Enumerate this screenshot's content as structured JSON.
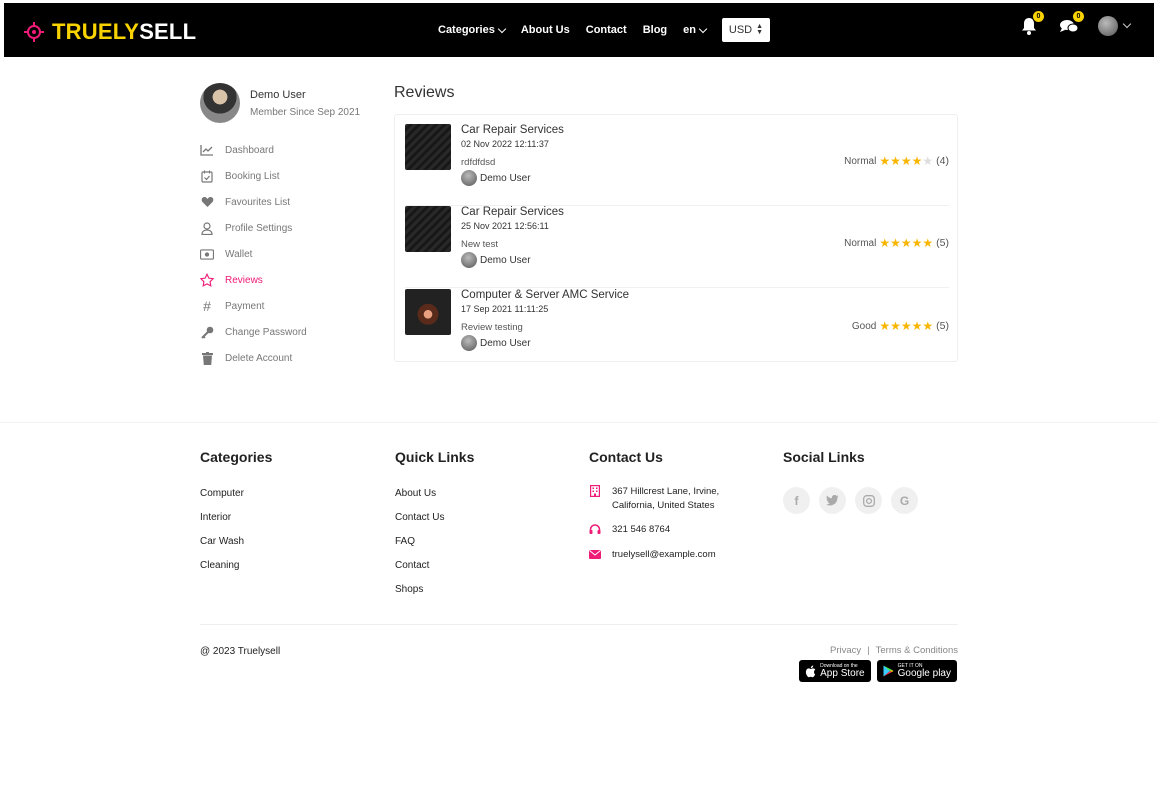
{
  "brand": {
    "part1": "TRUELY",
    "part2": "SELL"
  },
  "nav": {
    "items": [
      "Categories",
      "About Us",
      "Contact",
      "Blog",
      "en"
    ],
    "currency": "USD"
  },
  "header": {
    "notification_badge": "0",
    "chat_badge": "0"
  },
  "profile": {
    "name": "Demo User",
    "member_since": "Member Since Sep 2021"
  },
  "sidebar": {
    "items": [
      {
        "label": "Dashboard",
        "icon": "chart-line-icon"
      },
      {
        "label": "Booking List",
        "icon": "calendar-check-icon"
      },
      {
        "label": "Favourites List",
        "icon": "heart-icon"
      },
      {
        "label": "Profile Settings",
        "icon": "user-icon"
      },
      {
        "label": "Wallet",
        "icon": "money-icon"
      },
      {
        "label": "Reviews",
        "icon": "star-icon",
        "active": true
      },
      {
        "label": "Payment",
        "icon": "hashtag-icon"
      },
      {
        "label": "Change Password",
        "icon": "key-icon"
      },
      {
        "label": "Delete Account",
        "icon": "trash-icon"
      }
    ]
  },
  "reviews": {
    "title": "Reviews",
    "items": [
      {
        "service": "Car Repair Services",
        "date": "02 Nov 2022 12:11:37",
        "text": "rdfdfdsd",
        "user": "Demo User",
        "label": "Normal",
        "stars": 4,
        "score": "(4)"
      },
      {
        "service": "Car Repair Services",
        "date": "25 Nov 2021 12:56:11",
        "text": "New test",
        "user": "Demo User",
        "label": "Normal",
        "stars": 5,
        "score": "(5)"
      },
      {
        "service": "Computer & Server AMC Service",
        "date": "17 Sep 2021 11:11:25",
        "text": "Review testing",
        "user": "Demo User",
        "label": "Good",
        "stars": 5,
        "score": "(5)"
      }
    ]
  },
  "footer": {
    "categories": {
      "title": "Categories",
      "links": [
        "Computer",
        "Interior",
        "Car Wash",
        "Cleaning"
      ]
    },
    "quick_links": {
      "title": "Quick Links",
      "links": [
        "About Us",
        "Contact Us",
        "FAQ",
        "Contact",
        "Shops"
      ]
    },
    "contact": {
      "title": "Contact Us",
      "address_line1": "367 Hillcrest Lane, Irvine,",
      "address_line2": "California, United States",
      "phone": "321 546 8764",
      "email": "truelysell@example.com"
    },
    "social": {
      "title": "Social Links",
      "icons": [
        "facebook-icon",
        "twitter-icon",
        "instagram-icon",
        "google-icon"
      ]
    },
    "copyright": "@ 2023 Truelysell",
    "privacy": "Privacy",
    "terms": "Terms & Conditions",
    "app_store": {
      "small": "Download on the",
      "big": "App Store"
    },
    "google_play": {
      "small": "GET IT ON",
      "big": "Google play"
    }
  },
  "colors": {
    "accent": "#ee1b77",
    "brand_yellow": "#f9d300",
    "header_bg": "#000000",
    "star": "#f9b600"
  }
}
